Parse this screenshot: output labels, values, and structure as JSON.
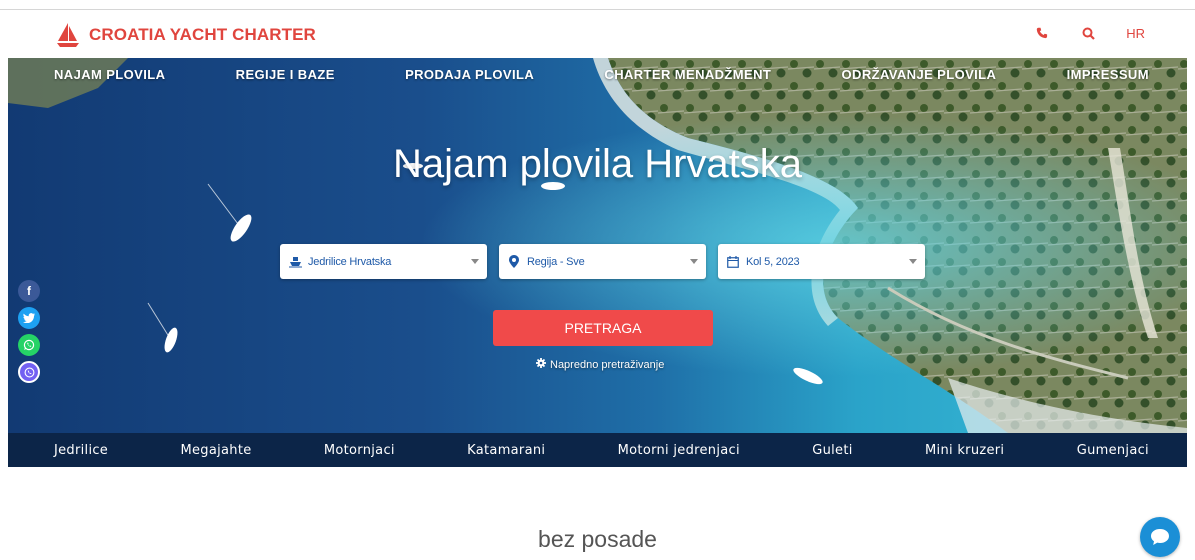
{
  "header": {
    "brand": "CROATIA YACHT CHARTER",
    "lang": "HR",
    "icons": [
      "phone-icon",
      "search-icon"
    ]
  },
  "nav": {
    "items": [
      "NAJAM PLOVILA",
      "REGIJE I BAZE",
      "PRODAJA PLOVILA",
      "CHARTER MENADŽMENT",
      "ODRŽAVANJE PLOVILA",
      "IMPRESSUM"
    ]
  },
  "hero": {
    "title": "Najam plovila Hrvatska",
    "filters": {
      "boat_type": "Jedrilice Hrvatska",
      "region": "Regija - Sve",
      "date": "Kol 5, 2023"
    },
    "search_label": "PRETRAGA",
    "advanced_label": "Napredno pretraživanje"
  },
  "categories": [
    "Jedrilice",
    "Megajahte",
    "Motornjaci",
    "Katamarani",
    "Motorni jedrenjaci",
    "Guleti",
    "Mini kruzeri",
    "Gumenjaci"
  ],
  "section": {
    "heading": "bez posade"
  },
  "colors": {
    "brand_red": "#e0453e",
    "button_red": "#f04a4a",
    "navy": "#0c2548",
    "link_blue": "#1f5aa8",
    "chat_blue": "#1b8fd6"
  }
}
